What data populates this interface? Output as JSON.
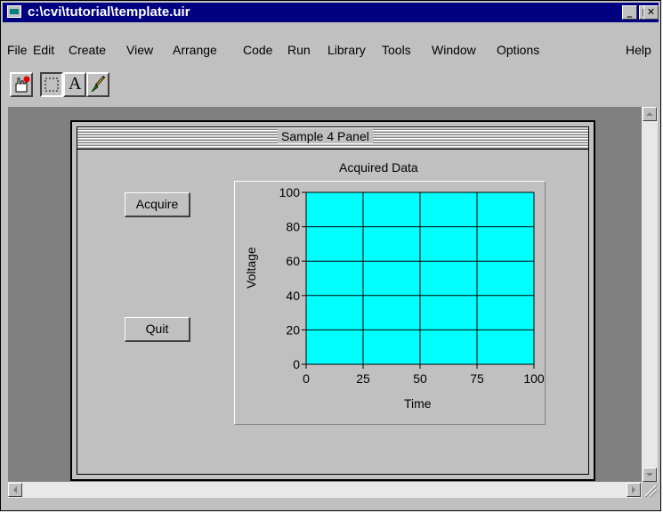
{
  "window": {
    "title": "c:\\cvi\\tutorial\\template.uir"
  },
  "menu": [
    "File",
    "Edit",
    "Create",
    "View",
    "Arrange",
    "Code",
    "Run",
    "Library",
    "Tools",
    "Window",
    "Options",
    "Help"
  ],
  "toolbar": {
    "tools": [
      {
        "icon": "operate-hand-icon"
      },
      {
        "icon": "selection-rectangle-icon",
        "active": true
      },
      {
        "icon": "text-tool-icon",
        "label": "A"
      },
      {
        "icon": "paint-brush-icon"
      }
    ]
  },
  "panel": {
    "title": "Sample 4 Panel",
    "buttons": {
      "acquire": "Acquire",
      "quit": "Quit"
    },
    "graph": {
      "title": "Acquired Data",
      "xlabel": "Time",
      "ylabel": "Voltage",
      "plot_color": "#00ffff"
    }
  },
  "chart_data": {
    "type": "line",
    "title": "Acquired Data",
    "xlabel": "Time",
    "ylabel": "Voltage",
    "xlim": [
      0,
      100
    ],
    "ylim": [
      0,
      100
    ],
    "x_ticks": [
      "0",
      "25",
      "50",
      "75",
      "100"
    ],
    "y_ticks": [
      "0",
      "20",
      "40",
      "60",
      "80",
      "100"
    ],
    "grid": true,
    "series": []
  }
}
